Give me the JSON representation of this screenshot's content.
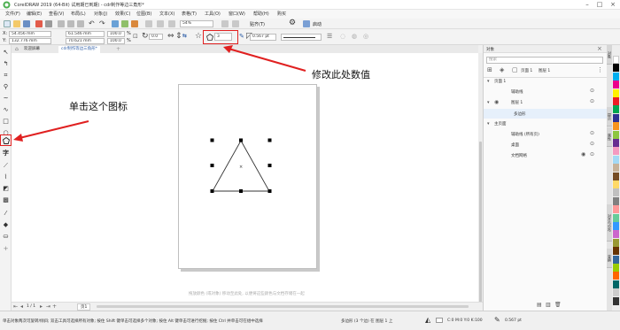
{
  "window": {
    "title": "CorelDRAW 2019 (64-Bit) 试用期已到期) - cdr制作等边三角形*",
    "icon": "coreldraw-logo"
  },
  "menu": [
    "文件(F)",
    "编辑(E)",
    "查看(V)",
    "布局(L)",
    "对象(J)",
    "效果(C)",
    "位图(B)",
    "文本(X)",
    "表格(T)",
    "工具(O)",
    "窗口(W)",
    "帮助(H)",
    "购买"
  ],
  "std_toolbar": {
    "zoom": "54%",
    "snap_label": "贴齐(T)",
    "launch_label": "启动"
  },
  "property_bar": {
    "x": "54.456 mm",
    "y": "132.776 mm",
    "w": "61.546 mm",
    "h": "70.621 mm",
    "scale_w": "100.0",
    "scale_h": "100.0",
    "rotation": "0.0",
    "sides": "3",
    "outline_width": "0.567 pt",
    "unit_symbol": "%"
  },
  "tabs": [
    {
      "label": "欢迎屏幕"
    },
    {
      "label": "cdr制作等边三角形*"
    }
  ],
  "annotations": {
    "right": "修改此处数值",
    "left": "单击这个图标",
    "color": "#e02020"
  },
  "docker": {
    "title": "对象",
    "search_placeholder": "搜索",
    "page_selector": "页面 1",
    "layer_selector": "图层 1",
    "tree": [
      {
        "label": "页面 1"
      },
      {
        "label": "辅助线"
      },
      {
        "label": "图层 1"
      },
      {
        "label": "多边形"
      },
      {
        "label": "主页面"
      },
      {
        "label": "辅助线 (所有页)"
      },
      {
        "label": "桌面"
      },
      {
        "label": "文档网格"
      }
    ],
    "side_tabs": [
      "对象",
      "提示",
      "属性",
      "对齐与分布",
      "变换"
    ]
  },
  "canvas_hint": "拖放颜色 (或对象) 移动至此处, 以便将这些颜色与文档存储在一起",
  "page_nav": {
    "count": "1 / 1",
    "tab": "页1"
  },
  "status": {
    "hint": "单击对象两次可旋转/倾斜; 双击工具可选择所有对象; 按住 Shift 键单击可选择多个对象; 按住 Alt 键单击可进行挖掘; 按住 Ctrl 并单击可在组中选择",
    "object_info": "多边形 (3 个边) 在 图层 1 上",
    "color_model": "C:0 M:0 Y:0 K:100",
    "outline": "0.567 pt"
  },
  "colors": {
    "accent": "#e02020",
    "palette": [
      "#ffffff",
      "#000000",
      "#00aeef",
      "#ec008c",
      "#fff200",
      "#ed1c24",
      "#00a651",
      "#2e3192",
      "#f7941d",
      "#8dc63f",
      "#662d91",
      "#f49ac1",
      "#a3d9f5",
      "#c7b299",
      "#754c24",
      "#ffd966",
      "#c0c0c0",
      "#808080",
      "#ff9999",
      "#66cc99",
      "#3399ff",
      "#cc66cc",
      "#999933",
      "#663300",
      "#336699",
      "#99cc00",
      "#ff6600",
      "#006666",
      "#cccccc",
      "#333333"
    ]
  }
}
